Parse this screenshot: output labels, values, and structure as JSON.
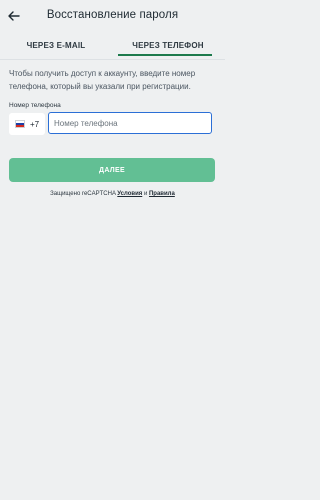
{
  "header": {
    "title": "Восстановление пароля",
    "back_icon": "arrow-left-icon"
  },
  "tabs": [
    {
      "label": "ЧЕРЕЗ E-MAIL",
      "active": false
    },
    {
      "label": "ЧЕРЕЗ ТЕЛЕФОН",
      "active": true
    }
  ],
  "info_text": "Чтобы получить доступ к аккаунту, введите номер телефона, который вы указали при регистрации.",
  "phone": {
    "label": "Номер телефона",
    "country_code": "+7",
    "flag_icon": "russia-flag-icon",
    "value": "",
    "placeholder": "Номер телефона"
  },
  "submit_label": "ДАЛЕЕ",
  "captcha": {
    "prefix": "Защищено reCAPTCHA",
    "terms": "Условия",
    "conjunction": "и",
    "rules": "Правила"
  },
  "colors": {
    "accent": "#1d7a4c",
    "button": "#62bf94",
    "input_border": "#2b6fd6",
    "background": "#eef0f1"
  }
}
